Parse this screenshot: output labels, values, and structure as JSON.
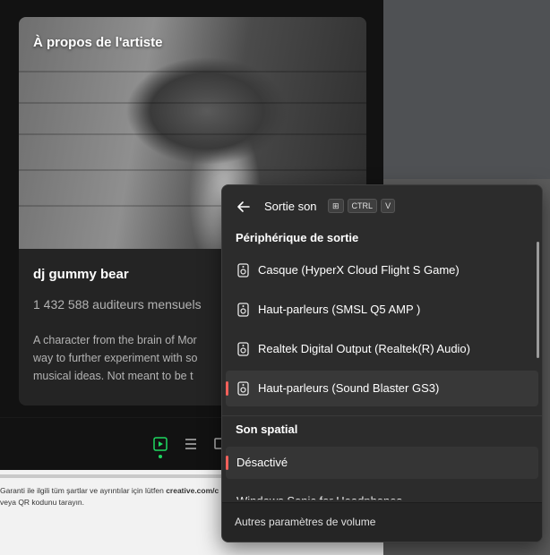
{
  "artist_panel": {
    "about_title": "À propos de l'artiste",
    "artist_name": "dj gummy bear",
    "monthly_listeners": "1 432 588 auditeurs mensuels",
    "bio_lines": [
      "A character from the brain of Mor",
      "way to further experiment with so",
      "musical ideas.   Not meant to be t"
    ]
  },
  "web_page": {
    "line1": "Garanti ile ilgili tüm şartlar ve ayrıntılar için lütfen ",
    "line1_bold": "creative.com/c",
    "line2": "veya QR kodunu tarayın."
  },
  "sound_flyout": {
    "title": "Sortie son",
    "shortcut_keys": [
      "⊞",
      "CTRL",
      "V"
    ],
    "output_section_title": "Périphérique de sortie",
    "devices": [
      {
        "label": "Casque (HyperX Cloud Flight S Game)",
        "selected": false
      },
      {
        "label": "Haut-parleurs (SMSL Q5 AMP  )",
        "selected": false
      },
      {
        "label": "Realtek Digital Output (Realtek(R) Audio)",
        "selected": false
      },
      {
        "label": "Haut-parleurs (Sound Blaster GS3)",
        "selected": true
      }
    ],
    "spatial_section_title": "Son spatial",
    "spatial_selected": "Désactivé",
    "spatial_next_partial": "Windows Sonic for Headphones",
    "footer_link": "Autres paramètres de volume"
  },
  "colors": {
    "accent": "#f2605a",
    "spotify_green": "#1ed760",
    "flyout_bg": "#2c2c2c"
  },
  "icons": [
    "back-arrow-icon",
    "windows-key-icon",
    "speaker-device-icon",
    "now-playing-view-icon",
    "queue-icon",
    "connect-device-icon"
  ]
}
